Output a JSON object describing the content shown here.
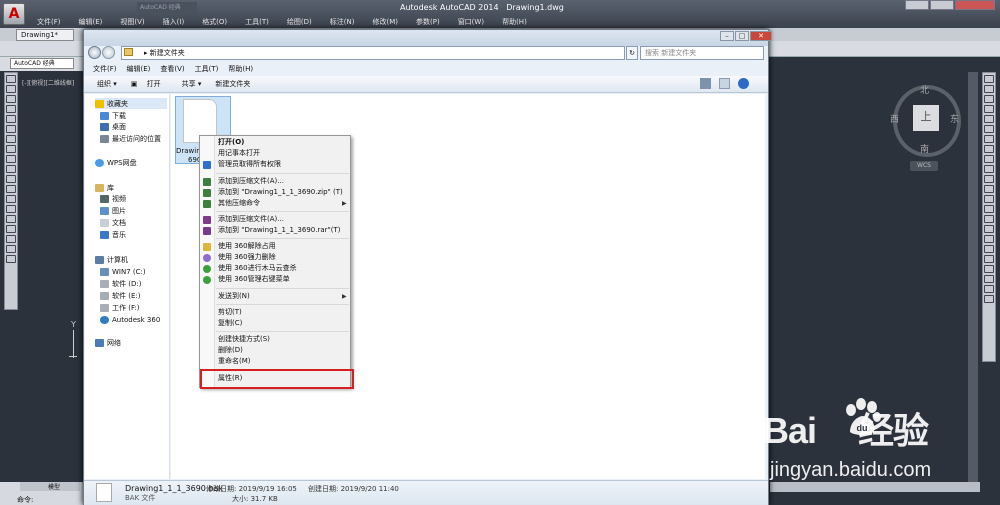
{
  "acad": {
    "app_title": "Autodesk AutoCAD 2014",
    "doc_title": "Drawing1.dwg",
    "search_placeholder": "AutoCAD 经典",
    "menu": [
      "文件(F)",
      "编辑(E)",
      "视图(V)",
      "插入(I)",
      "格式(O)",
      "工具(T)",
      "绘图(D)",
      "标注(N)",
      "修改(M)",
      "参数(P)",
      "窗口(W)",
      "帮助(H)"
    ],
    "tab": "Drawing1*",
    "workspace": "AutoCAD 经典",
    "viewport_label": "[-][俯视][二维线框]",
    "ucs_y": "Y",
    "viewcube": {
      "top": "上",
      "north": "北",
      "south": "南",
      "east": "东",
      "west": "西",
      "wcs": "WCS"
    },
    "layout_tab": "模型",
    "cmd_label": "命令:"
  },
  "explorer": {
    "path": "新建文件夹",
    "search_placeholder": "搜索 新建文件夹",
    "menu": [
      "文件(F)",
      "编辑(E)",
      "查看(V)",
      "工具(T)",
      "帮助(H)"
    ],
    "toolbar": [
      "组织 ▾",
      "打开",
      "共享 ▾",
      "新建文件夹"
    ],
    "nav": {
      "favorites": "收藏夹",
      "downloads": "下载",
      "desktop": "桌面",
      "recent": "最近访问的位置",
      "wps": "WPS网盘",
      "libraries": "库",
      "videos": "视频",
      "pictures": "图片",
      "documents": "文档",
      "music": "音乐",
      "computer": "计算机",
      "drive_c": "WIN7 (C:)",
      "drive_d": "软件 (D:)",
      "drive_e": "软件 (E:)",
      "drive_f": "工作 (F:)",
      "a360": "Autodesk 360",
      "network": "网络"
    },
    "file_label_1": "Drawin",
    "file_label_2": "690",
    "details": {
      "name": "Drawing1_1_1_3690.bak",
      "type": "BAK 文件",
      "modified_label": "修改日期: 2019/9/19 16:05",
      "size_label": "大小: 31.7 KB",
      "created_label": "创建日期: 2019/9/20 11:40"
    }
  },
  "context_menu": {
    "items": [
      "打开(O)",
      "用记事本打开",
      "管理员取得所有权限",
      "添加到压缩文件(A)...",
      "添加到 \"Drawing1_1_1_3690.zip\" (T)",
      "其他压缩命令",
      "添加到压缩文件(A)...",
      "添加到 \"Drawing1_1_1_3690.rar\"(T)",
      "使用 360解除占用",
      "使用 360强力删除",
      "使用 360进行木马云查杀",
      "使用 360管理右键菜单",
      "发送到(N)",
      "剪切(T)",
      "复制(C)",
      "创建快捷方式(S)",
      "删除(D)",
      "重命名(M)",
      "属性(R)"
    ],
    "icon_colors": {
      "winrar": "#7b3a8c",
      "zip": "#3d7f3d",
      "shield": "#2f6fcf",
      "purple": "#8d6ad6",
      "green360": "#3aa33a"
    }
  },
  "watermark": {
    "line1": "Bai",
    "line2": "经验",
    "line3": "jingyan.baidu.com"
  }
}
